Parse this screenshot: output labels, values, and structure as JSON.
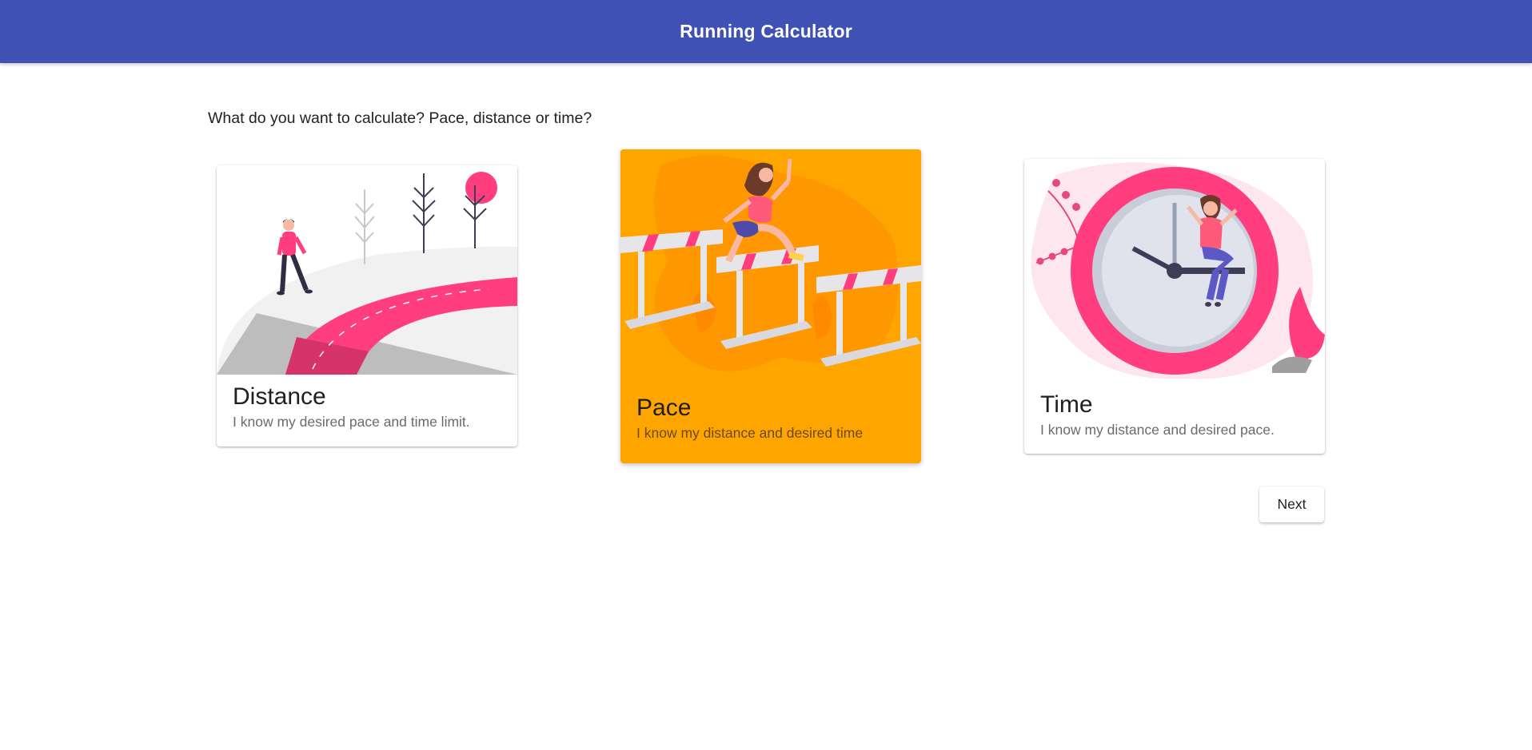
{
  "appbar": {
    "title": "Running Calculator"
  },
  "question": "What do you want to calculate? Pace, distance or time?",
  "cards": {
    "distance": {
      "title": "Distance",
      "description": "I know my desired pace and time limit.",
      "illustration": "walking-person-road-illustration"
    },
    "pace": {
      "title": "Pace",
      "description": "I know my distance and desired time",
      "illustration": "runner-hurdles-illustration",
      "selected": true
    },
    "time": {
      "title": "Time",
      "description": "I know my distance and desired pace.",
      "illustration": "woman-on-clock-illustration"
    }
  },
  "actions": {
    "next_label": "Next"
  },
  "colors": {
    "primary": "#3f51b5",
    "selected_card": "#ffa500",
    "accent_pink": "#ff3d7f"
  }
}
